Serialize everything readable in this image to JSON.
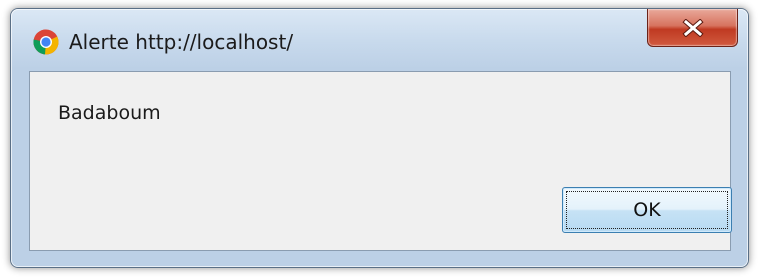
{
  "dialog": {
    "title": "Alerte http://localhost/",
    "message": "Badaboum",
    "ok_label": "OK",
    "icon": "chrome-browser-icon",
    "close_icon": "close-icon"
  },
  "colors": {
    "close_button": "#c9472d",
    "ok_button_border": "#3c7fb1",
    "content_background": "#f0f0f0",
    "frame": "#c7d9ec"
  }
}
